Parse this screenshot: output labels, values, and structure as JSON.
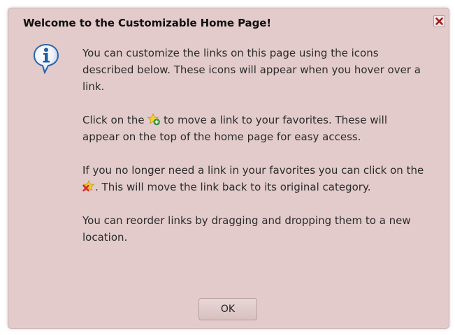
{
  "dialog": {
    "title": "Welcome to the Customizable Home Page!",
    "close_icon": "close-icon",
    "info_icon": "info-icon",
    "paragraphs": {
      "p1": "You can customize the links on this page using the icons described below. These icons will appear when you hover over a link.",
      "p2_before": "Click on the ",
      "p2_after": " to move a link to your favorites. These will appear on the top of the home page for easy access.",
      "p3_before": "If you no longer need a link in your favorites you can click on the ",
      "p3_after": ". This will move the link back to its original category.",
      "p4": "You can reorder links by dragging and dropping them to a new location."
    },
    "icons": {
      "add_favorite": "star-add-icon",
      "remove_favorite": "star-remove-icon"
    },
    "ok_label": "OK",
    "colors": {
      "background": "#e3cbcb",
      "close_x": "#a01818",
      "info_blue": "#1f5fa8"
    }
  }
}
